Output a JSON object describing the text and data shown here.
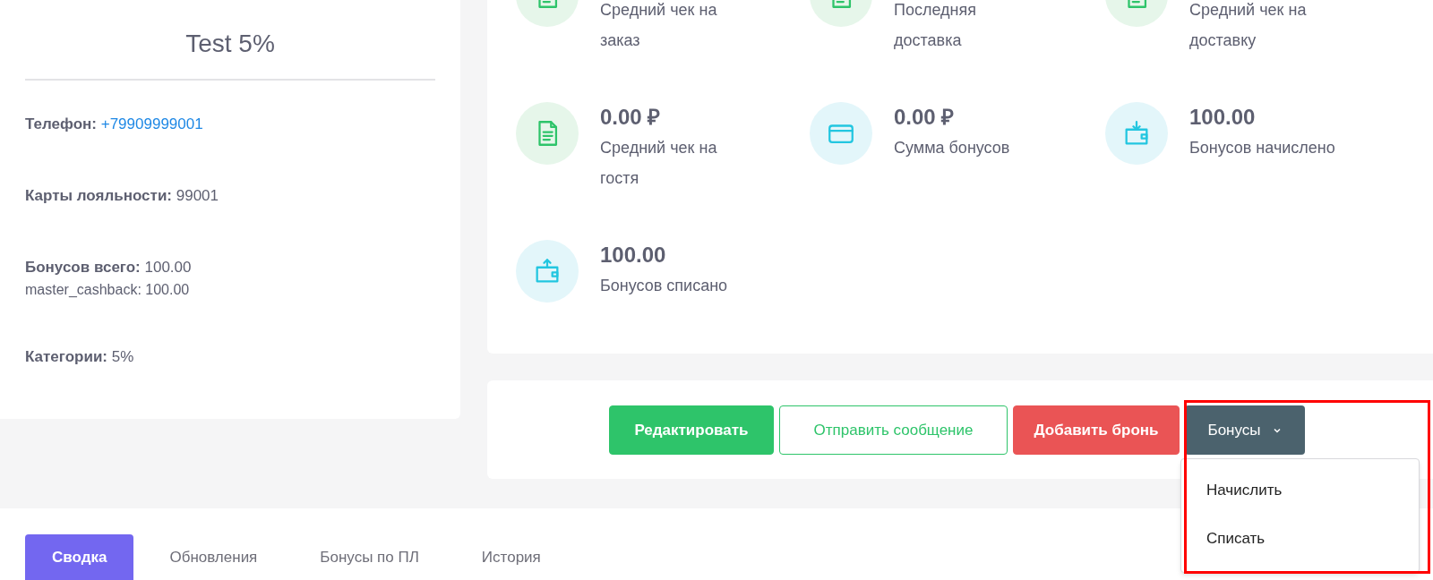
{
  "profile": {
    "name": "Test 5%",
    "fields": [
      {
        "kind": "link",
        "label": "Телефон:",
        "value": "+79909999001"
      },
      {
        "kind": "plain",
        "label": "Карты лояльности:",
        "value": "99001"
      },
      {
        "kind": "plain",
        "label": "Бонусов всего:",
        "value": "100.00",
        "sub": "master_cashback: 100.00"
      },
      {
        "kind": "plain",
        "label": "Категории:",
        "value": "5%"
      }
    ]
  },
  "stats": [
    {
      "kind": "document",
      "label": "Средний чек на заказ"
    },
    {
      "kind": "document",
      "label": "Последняя доставка"
    },
    {
      "kind": "document",
      "label": "Средний чек на доставку"
    },
    {
      "kind": "document",
      "value": "0.00 ₽",
      "label": "Средний чек на гостя"
    },
    {
      "kind": "card",
      "value": "0.00 ₽",
      "label": "Сумма бонусов"
    },
    {
      "kind": "wallet-in",
      "value": "100.00",
      "label": "Бонусов начислено"
    },
    {
      "kind": "wallet-out",
      "value": "100.00",
      "label": "Бонусов списано"
    }
  ],
  "actions": [
    {
      "kind": "primary",
      "label": "Редактировать"
    },
    {
      "kind": "outline",
      "label": "Отправить сообщение"
    },
    {
      "kind": "danger",
      "label": "Добавить бронь"
    },
    {
      "kind": "dropdown",
      "label": "Бонусы",
      "expanded": true,
      "items": [
        "Начислить",
        "Списать"
      ]
    }
  ],
  "tabs": [
    {
      "label": "Сводка",
      "selected": true
    },
    {
      "label": "Обновления",
      "selected": false
    },
    {
      "label": "Бонусы по ПЛ",
      "selected": false
    },
    {
      "label": "История",
      "selected": false
    }
  ]
}
